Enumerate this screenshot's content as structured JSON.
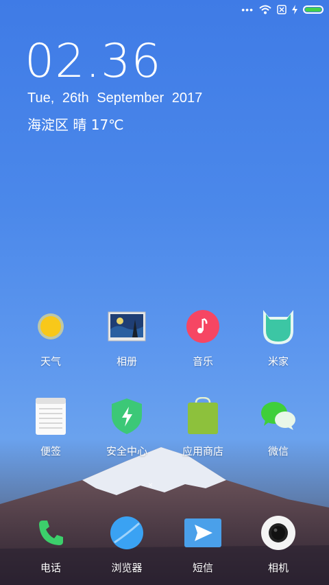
{
  "status": {
    "dots": "•••",
    "wifi_icon": "wifi-icon",
    "sim_icon": "no-sim-icon",
    "charging_icon": "charging-icon",
    "battery_level": 1.0,
    "battery_color": "#43d04a"
  },
  "lockscreen": {
    "time": "02.36",
    "date": "Tue,  26th  September  2017",
    "weather": "海淀区 晴 17℃"
  },
  "page_indicator": "×",
  "apps_row1": [
    {
      "label": "天气",
      "icon": "weather-sun-icon"
    },
    {
      "label": "相册",
      "icon": "gallery-icon"
    },
    {
      "label": "音乐",
      "icon": "music-icon"
    },
    {
      "label": "米家",
      "icon": "mijia-icon"
    }
  ],
  "apps_row2": [
    {
      "label": "便签",
      "icon": "notes-icon"
    },
    {
      "label": "安全中心",
      "icon": "security-icon"
    },
    {
      "label": "应用商店",
      "icon": "app-store-icon"
    },
    {
      "label": "微信",
      "icon": "wechat-icon"
    }
  ],
  "dock": [
    {
      "label": "电话",
      "icon": "phone-icon"
    },
    {
      "label": "浏览器",
      "icon": "browser-icon"
    },
    {
      "label": "短信",
      "icon": "messages-icon"
    },
    {
      "label": "相机",
      "icon": "camera-icon"
    }
  ]
}
